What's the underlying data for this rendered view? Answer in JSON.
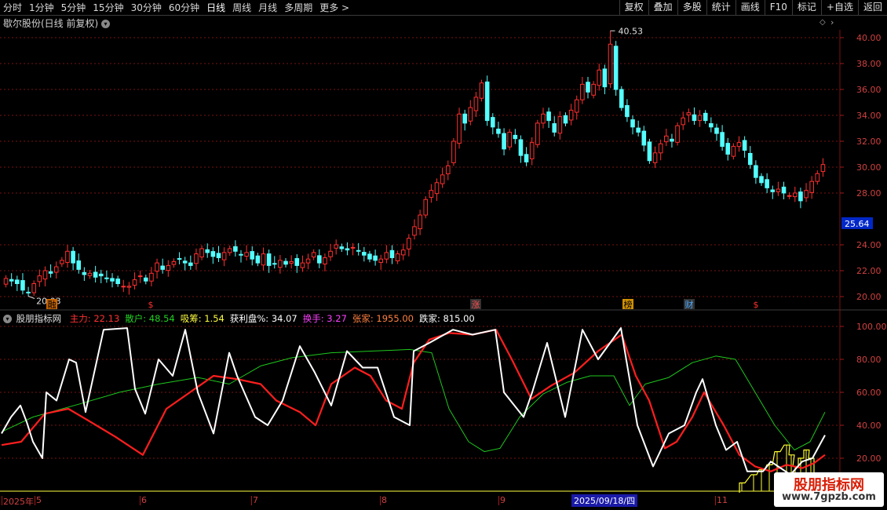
{
  "toolbar": {
    "periods": [
      "分时",
      "1分钟",
      "5分钟",
      "15分钟",
      "30分钟",
      "60分钟",
      "日线",
      "周线",
      "月线",
      "多周期",
      "更多 >"
    ],
    "active": "日线",
    "right_buttons": [
      "复权",
      "叠加",
      "多股",
      "统计",
      "画线",
      "F10",
      "标记",
      "+自选",
      "返回"
    ]
  },
  "header": {
    "title": "歇尔股份(日线 前复权)"
  },
  "main_chart": {
    "yticks": [
      "40.00",
      "38.00",
      "36.00",
      "34.00",
      "32.00",
      "30.00",
      "28.00",
      "24.00",
      "22.00",
      "20.00"
    ],
    "current_price": "25.64",
    "high_label": "40.53",
    "low_label": "20.03",
    "markers": [
      {
        "text": "融",
        "color": "#d06800"
      },
      {
        "text": "$",
        "color": "#ff3030"
      },
      {
        "text": "涨",
        "color": "#ff5050"
      },
      {
        "text": "榜",
        "color": "#ff9000"
      },
      {
        "text": "财",
        "color": "#4aa8ff"
      },
      {
        "text": "$",
        "color": "#ff3030"
      }
    ]
  },
  "indicator": {
    "name": "股朋指标网",
    "fields": [
      {
        "label": "主力: 22.13",
        "color": "#ff3030"
      },
      {
        "label": "散户: 48.54",
        "color": "#22d022"
      },
      {
        "label": "吸筹: 1.54",
        "color": "#ffff40"
      },
      {
        "label": "获利盘%: 34.07",
        "color": "#ffffff"
      },
      {
        "label": "换手: 3.27",
        "color": "#ff40ff"
      },
      {
        "label": "张家: 1955.00",
        "color": "#ff8040"
      },
      {
        "label": "跌家: 815.00",
        "color": "#ffffff"
      }
    ],
    "yticks": [
      "100.00",
      "80.00",
      "60.00",
      "40.00",
      "20.00"
    ]
  },
  "timeline": {
    "labels": [
      "2025年",
      "5",
      "6",
      "7",
      "8",
      "9",
      "11"
    ],
    "cursor_date": "2025/09/18/四"
  },
  "watermark": {
    "line1": "股朋指标网",
    "line2": "www.7gpzb.com"
  },
  "colors": {
    "up": "#ff3030",
    "down": "#54ffff",
    "grid": "#7a1212",
    "main": "#ff1e1e",
    "retail": "#1ec81e",
    "profit": "#ffffff",
    "absorb": "#ffff30"
  },
  "chart_data": [
    {
      "type": "candlestick",
      "title": "歇尔股份(日线 前复权)",
      "y_ticks": [
        20,
        22,
        24,
        28,
        30,
        32,
        34,
        36,
        38,
        40
      ],
      "annotations": {
        "high": 40.53,
        "low": 20.03,
        "last": 25.64
      },
      "closes": [
        21.4,
        21.2,
        21.0,
        20.5,
        20.3,
        21.0,
        21.6,
        22.0,
        21.8,
        22.3,
        22.8,
        23.5,
        22.6,
        22.1,
        21.7,
        21.8,
        21.5,
        21.6,
        21.4,
        21.2,
        21.0,
        20.8,
        20.8,
        21.3,
        21.6,
        21.2,
        21.8,
        22.6,
        22.1,
        22.4,
        22.7,
        22.9,
        22.6,
        22.4,
        23.3,
        23.7,
        23.4,
        23.1,
        23.0,
        23.4,
        23.7,
        23.5,
        23.2,
        23.4,
        22.9,
        22.6,
        23.3,
        22.4,
        22.5,
        22.8,
        22.5,
        22.7,
        22.4,
        22.6,
        22.9,
        23.4,
        22.6,
        23.0,
        23.5,
        24.0,
        23.7,
        23.6,
        23.8,
        23.5,
        23.2,
        22.9,
        22.8,
        22.9,
        23.4,
        23.0,
        23.3,
        23.6,
        24.5,
        25.4,
        26.3,
        27.5,
        28.2,
        28.8,
        29.4,
        30.1,
        32.0,
        34.1,
        33.4,
        34.6,
        35.4,
        36.5,
        33.6,
        33.1,
        32.6,
        31.4,
        32.7,
        32.2,
        30.9,
        30.4,
        31.9,
        33.4,
        34.1,
        33.6,
        32.7,
        33.9,
        33.4,
        34.4,
        35.2,
        36.4,
        35.8,
        36.4,
        37.5,
        36.2,
        39.5,
        36.0,
        34.6,
        33.9,
        33.1,
        32.7,
        31.7,
        30.5,
        31.1,
        31.8,
        32.4,
        32.0,
        33.2,
        33.8,
        34.2,
        33.6,
        34.0,
        33.6,
        33.1,
        32.6,
        31.6,
        31.0,
        31.6,
        31.9,
        31.3,
        30.2,
        29.2,
        28.8,
        28.4,
        28.1,
        28.3,
        28.0,
        27.8,
        28.0,
        27.4,
        28.2,
        28.9,
        29.5,
        30.2
      ]
    },
    {
      "type": "line",
      "y_ticks": [
        20,
        40,
        60,
        80,
        100
      ],
      "series": [
        {
          "name": "获利盘%",
          "points": [
            [
              0,
              35
            ],
            [
              12,
              45
            ],
            [
              24,
              52
            ],
            [
              32,
              42
            ],
            [
              40,
              30
            ],
            [
              52,
              20
            ],
            [
              57,
              60
            ],
            [
              70,
              55
            ],
            [
              86,
              80
            ],
            [
              95,
              78
            ],
            [
              107,
              48
            ],
            [
              130,
              98
            ],
            [
              160,
              99
            ],
            [
              170,
              62
            ],
            [
              183,
              47
            ],
            [
              200,
              80
            ],
            [
              218,
              70
            ],
            [
              234,
              98
            ],
            [
              250,
              60
            ],
            [
              270,
              35
            ],
            [
              290,
              84
            ],
            [
              300,
              70
            ],
            [
              323,
              45
            ],
            [
              339,
              40
            ],
            [
              358,
              55
            ],
            [
              380,
              88
            ],
            [
              399,
              72
            ],
            [
              420,
              52
            ],
            [
              440,
              85
            ],
            [
              460,
              75
            ],
            [
              479,
              75
            ],
            [
              500,
              45
            ],
            [
              520,
              40
            ],
            [
              525,
              85
            ],
            [
              545,
              90
            ],
            [
              575,
              98
            ],
            [
              600,
              95
            ],
            [
              629,
              98
            ],
            [
              640,
              60
            ],
            [
              665,
              45
            ],
            [
              676,
              60
            ],
            [
              695,
              90
            ],
            [
              718,
              45
            ],
            [
              740,
              98
            ],
            [
              760,
              80
            ],
            [
              789,
              99
            ],
            [
              810,
              40
            ],
            [
              830,
              15
            ],
            [
              850,
              35
            ],
            [
              870,
              40
            ],
            [
              885,
              60
            ],
            [
              893,
              68
            ],
            [
              910,
              40
            ],
            [
              923,
              25
            ],
            [
              937,
              30
            ],
            [
              950,
              12
            ],
            [
              970,
              12
            ],
            [
              980,
              18
            ],
            [
              1005,
              10
            ],
            [
              1020,
              18
            ],
            [
              1033,
              20
            ],
            [
              1049,
              34
            ]
          ]
        },
        {
          "name": "主力",
          "points": [
            [
              0,
              28
            ],
            [
              25,
              30
            ],
            [
              55,
              47
            ],
            [
              85,
              50
            ],
            [
              110,
              43
            ],
            [
              145,
              33
            ],
            [
              180,
              22
            ],
            [
              210,
              50
            ],
            [
              240,
              60
            ],
            [
              270,
              70
            ],
            [
              300,
              68
            ],
            [
              330,
              65
            ],
            [
              350,
              55
            ],
            [
              380,
              48
            ],
            [
              400,
              40
            ],
            [
              420,
              65
            ],
            [
              450,
              75
            ],
            [
              470,
              70
            ],
            [
              490,
              55
            ],
            [
              510,
              50
            ],
            [
              525,
              78
            ],
            [
              545,
              92
            ],
            [
              570,
              96
            ],
            [
              600,
              95
            ],
            [
              630,
              98
            ],
            [
              650,
              80
            ],
            [
              675,
              56
            ],
            [
              700,
              64
            ],
            [
              730,
              72
            ],
            [
              760,
              85
            ],
            [
              790,
              95
            ],
            [
              808,
              70
            ],
            [
              825,
              55
            ],
            [
              845,
              26
            ],
            [
              860,
              30
            ],
            [
              880,
              45
            ],
            [
              895,
              60
            ],
            [
              920,
              40
            ],
            [
              940,
              22
            ],
            [
              960,
              15
            ],
            [
              980,
              12
            ],
            [
              1000,
              16
            ],
            [
              1020,
              14
            ],
            [
              1035,
              17
            ],
            [
              1049,
              22
            ]
          ]
        },
        {
          "name": "散户",
          "points": [
            [
              0,
              36
            ],
            [
              40,
              45
            ],
            [
              100,
              53
            ],
            [
              150,
              60
            ],
            [
              200,
              65
            ],
            [
              250,
              69
            ],
            [
              290,
              65
            ],
            [
              330,
              76
            ],
            [
              370,
              81
            ],
            [
              420,
              84
            ],
            [
              470,
              85
            ],
            [
              520,
              86
            ],
            [
              548,
              84
            ],
            [
              570,
              50
            ],
            [
              595,
              30
            ],
            [
              615,
              24
            ],
            [
              635,
              26
            ],
            [
              660,
              45
            ],
            [
              690,
              59
            ],
            [
              720,
              66
            ],
            [
              750,
              70
            ],
            [
              780,
              70
            ],
            [
              800,
              52
            ],
            [
              820,
              65
            ],
            [
              850,
              69
            ],
            [
              880,
              78
            ],
            [
              910,
              82
            ],
            [
              935,
              80
            ],
            [
              960,
              60
            ],
            [
              985,
              40
            ],
            [
              1010,
              25
            ],
            [
              1030,
              30
            ],
            [
              1049,
              48
            ]
          ]
        },
        {
          "name": "吸筹",
          "points": [
            [
              940,
              5
            ],
            [
              955,
              10
            ],
            [
              965,
              13
            ],
            [
              975,
              16
            ],
            [
              985,
              24
            ],
            [
              997,
              28
            ],
            [
              1003,
              22
            ],
            [
              1008,
              15
            ],
            [
              1015,
              20
            ],
            [
              1022,
              25
            ],
            [
              1028,
              20
            ],
            [
              1035,
              10
            ]
          ]
        }
      ]
    }
  ]
}
